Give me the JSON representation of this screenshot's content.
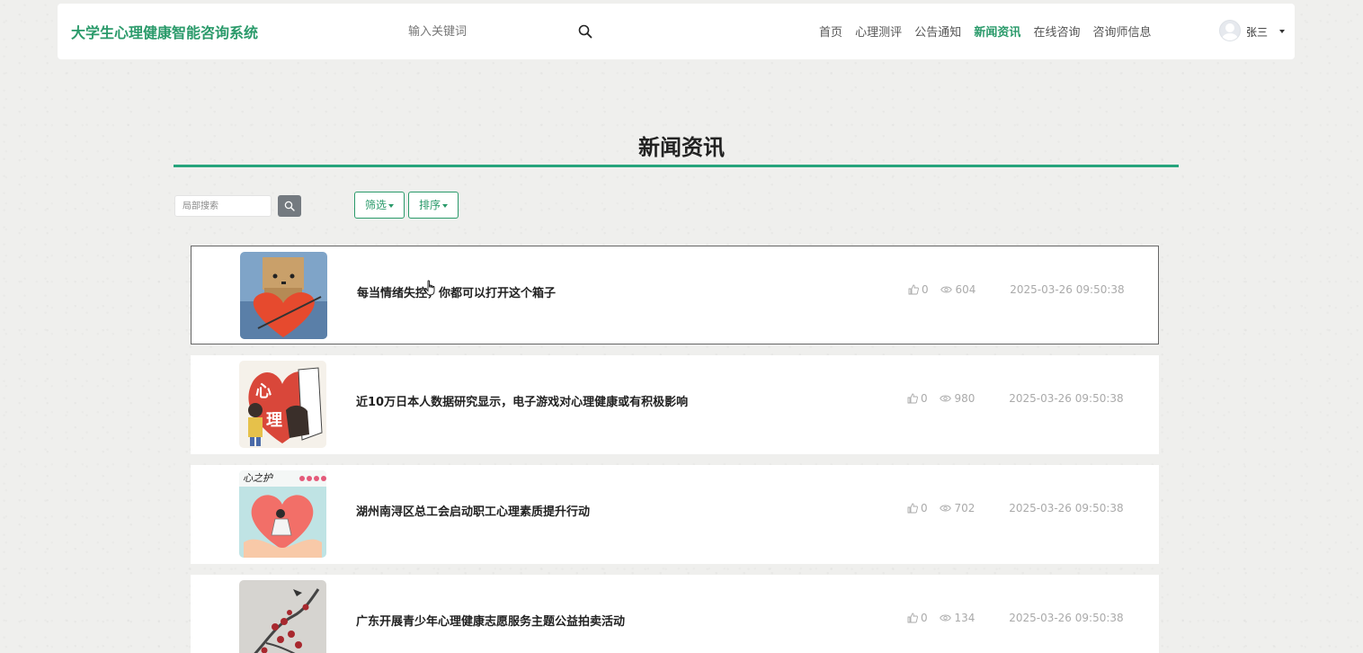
{
  "header": {
    "brand": "大学生心理健康智能咨询系统",
    "search_placeholder": "输入关键词",
    "nav": [
      {
        "label": "首页",
        "active": false
      },
      {
        "label": "心理测评",
        "active": false
      },
      {
        "label": "公告通知",
        "active": false
      },
      {
        "label": "新闻资讯",
        "active": true
      },
      {
        "label": "在线咨询",
        "active": false
      },
      {
        "label": "咨询师信息",
        "active": false
      }
    ],
    "user_name": "张三"
  },
  "page": {
    "title": "新闻资讯",
    "local_search_placeholder": "局部搜索",
    "filter_label": "筛选",
    "sort_label": "排序"
  },
  "colors": {
    "accent": "#2a9a6a",
    "title_rule": "#26a47c",
    "meta_text": "#aaaaaa"
  },
  "news": [
    {
      "title": "每当情绪失控，你都可以打开这个箱子",
      "likes": "0",
      "views": "604",
      "date": "2025-03-26 09:50:38",
      "thumb": "cardboard-box-heart"
    },
    {
      "title": "近10万日本人数据研究显示，电子游戏对心理健康或有积极影响",
      "likes": "0",
      "views": "980",
      "date": "2025-03-26 09:50:38",
      "thumb": "psychology-heart-illustration"
    },
    {
      "title": "湖州南浔区总工会启动职工心理素质提升行动",
      "likes": "0",
      "views": "702",
      "date": "2025-03-26 09:50:38",
      "thumb": "heart-guard-poster"
    },
    {
      "title": "广东开展青少年心理健康志愿服务主题公益拍卖活动",
      "likes": "0",
      "views": "134",
      "date": "2025-03-26 09:50:38",
      "thumb": "plum-blossom-painting"
    }
  ]
}
